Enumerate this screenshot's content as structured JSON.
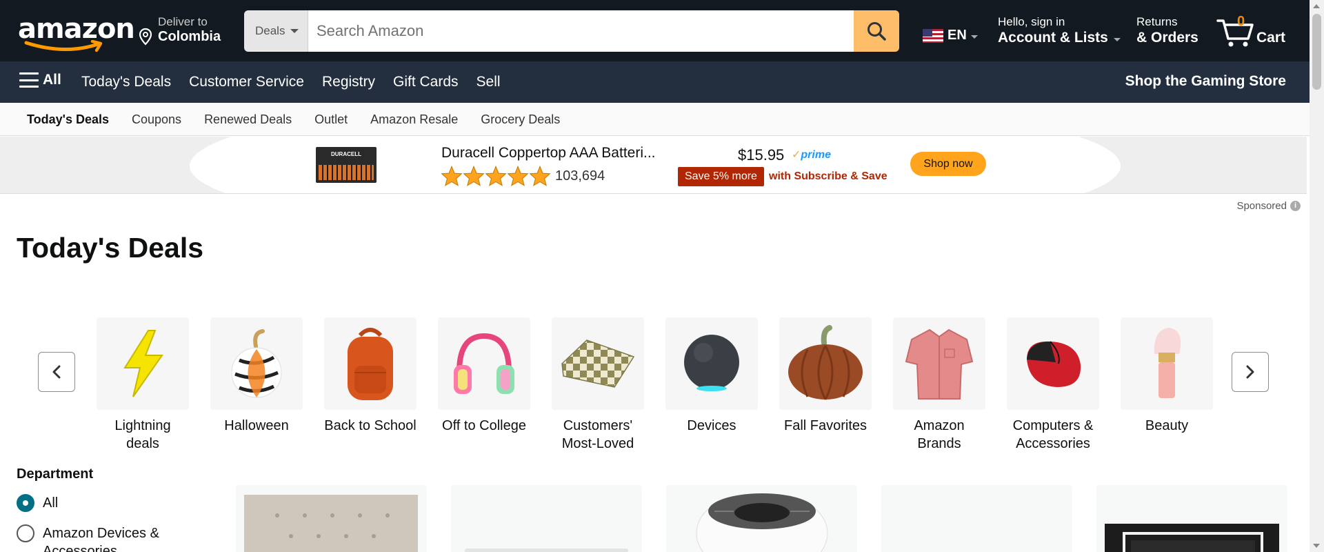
{
  "header": {
    "logo_text": "amazon",
    "deliver_line1": "Deliver to",
    "deliver_line2": "Colombia",
    "search": {
      "category": "Deals",
      "placeholder": "Search Amazon"
    },
    "language": "EN",
    "account_line1": "Hello, sign in",
    "account_line2": "Account & Lists",
    "returns_line1": "Returns",
    "returns_line2": "& Orders",
    "cart_count": "0",
    "cart_label": "Cart"
  },
  "nav": {
    "all_label": "All",
    "links": [
      "Today's Deals",
      "Customer Service",
      "Registry",
      "Gift Cards",
      "Sell"
    ],
    "promo": "Shop the Gaming Store"
  },
  "subnav": {
    "items": [
      "Today's Deals",
      "Coupons",
      "Renewed Deals",
      "Outlet",
      "Amazon Resale",
      "Grocery Deals"
    ]
  },
  "banner": {
    "product_brand": "DURACELL",
    "title": "Duracell Coppertop AAA Batteri...",
    "rating": 5,
    "rating_count": "103,694",
    "price": "$15.95",
    "prime_label": "prime",
    "save_badge": "Save 5% more",
    "subscribe_text": "with Subscribe & Save",
    "cta": "Shop now"
  },
  "sponsored_label": "Sponsored",
  "page_title": "Today's Deals",
  "categories": [
    {
      "label": "Lightning deals",
      "icon": "lightning-bolt"
    },
    {
      "label": "Halloween",
      "icon": "decorative-pumpkin"
    },
    {
      "label": "Back to School",
      "icon": "backpack"
    },
    {
      "label": "Off to College",
      "icon": "headphones"
    },
    {
      "label": "Customers' Most-Loved",
      "icon": "checkered-blanket"
    },
    {
      "label": "Devices",
      "icon": "smart-speaker"
    },
    {
      "label": "Fall Favorites",
      "icon": "plush-pumpkin"
    },
    {
      "label": "Amazon Brands",
      "icon": "shirt"
    },
    {
      "label": "Computers & Accessories",
      "icon": "computer-mouse"
    },
    {
      "label": "Beauty",
      "icon": "makeup-brush"
    }
  ],
  "department": {
    "title": "Department",
    "options": [
      {
        "label": "All",
        "checked": true
      },
      {
        "label": "Amazon Devices & Accessories",
        "checked": false
      }
    ]
  },
  "colors": {
    "header_bg": "#131921",
    "nav_bg": "#232f3e",
    "search_button": "#febd69",
    "cart_count": "#f08804",
    "deal_red": "#b12704",
    "cta_orange": "#ffa41c",
    "radio_teal": "#007185"
  }
}
